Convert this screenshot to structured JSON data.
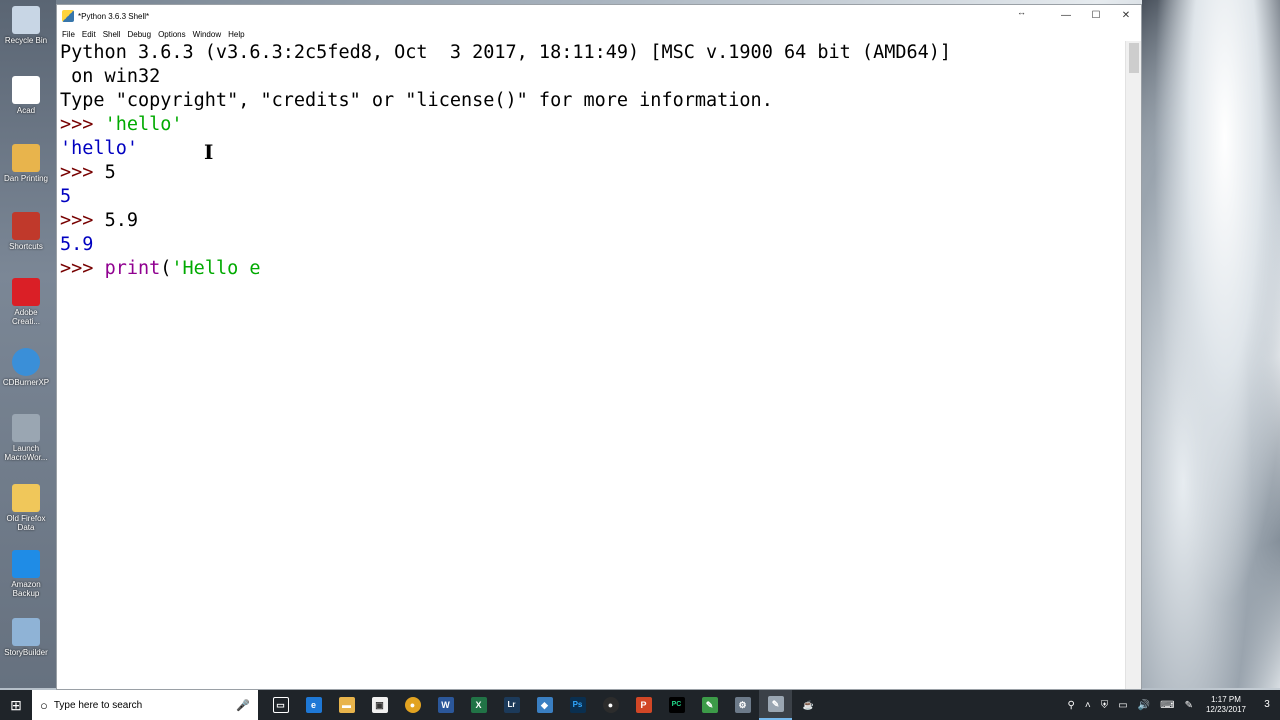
{
  "desktop": {
    "icons": [
      {
        "label": "Recycle Bin",
        "icon": "recycle-bin-icon",
        "color": "#c8d6e5"
      },
      {
        "label": "Acad",
        "icon": "acad-icon",
        "color": "#ffffff"
      },
      {
        "label": "Dan Printing",
        "icon": "folder-icon",
        "color": "#e8b44c"
      },
      {
        "label": "Shortcuts",
        "icon": "shortcuts-icon",
        "color": "#c0392b"
      },
      {
        "label": "Adobe Creati...",
        "icon": "adobe-cc-icon",
        "color": "#da1f26"
      },
      {
        "label": "CDBurnerXP",
        "icon": "cdburner-icon",
        "color": "#3a8fd8"
      },
      {
        "label": "Launch MacroWor...",
        "icon": "macroworks-icon",
        "color": "#9aa6b2"
      },
      {
        "label": "Old Firefox Data",
        "icon": "folder-icon",
        "color": "#f0c75a"
      },
      {
        "label": "Amazon Backup",
        "icon": "amazon-backup-icon",
        "color": "#1f8ce6"
      },
      {
        "label": "StoryBuilder",
        "icon": "storybuilder-icon",
        "color": "#8fb3d6"
      }
    ]
  },
  "window": {
    "title": "*Python 3.6.3 Shell*",
    "controls": {
      "minimize": "—",
      "maximize": "☐",
      "close": "✕"
    },
    "resize_glyph": "↔",
    "menu": [
      "File",
      "Edit",
      "Shell",
      "Debug",
      "Options",
      "Window",
      "Help"
    ]
  },
  "shell": {
    "banner1": "Python 3.6.3 (v3.6.3:2c5fed8, Oct  3 2017, 18:11:49) [MSC v.1900 64 bit (AMD64)]",
    "banner2": " on win32",
    "banner3": "Type \"copyright\", \"credits\" or \"license()\" for more information.",
    "prompt": ">>> ",
    "entries": [
      {
        "input": "'hello'",
        "output": "'hello'"
      },
      {
        "input": "5",
        "output": "5"
      },
      {
        "input": "5.9",
        "output": "5.9"
      }
    ],
    "current": {
      "builtin": "print",
      "open": "(",
      "string": "'Hello e"
    }
  },
  "taskbar": {
    "start_glyph": "⊞",
    "search_placeholder": "Type here to search",
    "search_glyph": "○",
    "mic_glyph": "🎤",
    "apps": [
      {
        "name": "task-view-icon",
        "label": "▭",
        "color": "#1f2429"
      },
      {
        "name": "edge-icon",
        "label": "e",
        "color": "#1e78d6"
      },
      {
        "name": "file-explorer-icon",
        "label": "▬",
        "color": "#e8b44c"
      },
      {
        "name": "store-icon",
        "label": "▣",
        "color": "#f0f0f0"
      },
      {
        "name": "chrome-icon",
        "label": "●",
        "color": "#e2a321"
      },
      {
        "name": "word-icon",
        "label": "W",
        "color": "#2b579a"
      },
      {
        "name": "excel-icon",
        "label": "X",
        "color": "#217346"
      },
      {
        "name": "lightroom-icon",
        "label": "Lr",
        "color": "#1c3a5a"
      },
      {
        "name": "app-blue-icon",
        "label": "◆",
        "color": "#3a7fc2"
      },
      {
        "name": "photoshop-icon",
        "label": "Ps",
        "color": "#0a2f4f"
      },
      {
        "name": "obs-icon",
        "label": "●",
        "color": "#2c2c2c"
      },
      {
        "name": "powerpoint-icon",
        "label": "P",
        "color": "#d24726"
      },
      {
        "name": "pycharm-icon",
        "label": "PC",
        "color": "#21d789"
      },
      {
        "name": "notepad-icon",
        "label": "✎",
        "color": "#3c9b48"
      },
      {
        "name": "settings-app-icon",
        "label": "⚙",
        "color": "#6c7a89"
      },
      {
        "name": "idle-icon",
        "label": "✎",
        "color": "#9aa6b2"
      },
      {
        "name": "java-icon",
        "label": "☕",
        "color": "#e76f00"
      }
    ],
    "tray": {
      "icons": [
        "⚲",
        "˄",
        "⛨",
        "▭",
        "🔊",
        "⌨",
        "✎"
      ],
      "time": "1:17 PM",
      "date": "12/23/2017",
      "notifications": "3"
    }
  }
}
